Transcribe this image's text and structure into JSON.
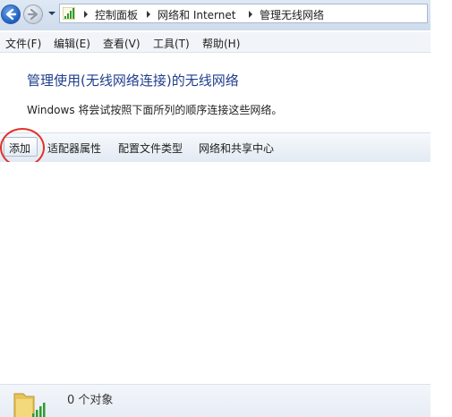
{
  "address_bar": {
    "breadcrumbs": [
      "控制面板",
      "网络和 Internet",
      "管理无线网络"
    ]
  },
  "menu": {
    "items": [
      "文件(F)",
      "编辑(E)",
      "查看(V)",
      "工具(T)",
      "帮助(H)"
    ]
  },
  "header": {
    "title": "管理使用(无线网络连接)的无线网络",
    "description": "Windows 将尝试按照下面所列的顺序连接这些网络。"
  },
  "commands": {
    "add": "添加",
    "adapter_properties": "适配器属性",
    "profile_types": "配置文件类型",
    "network_sharing_center": "网络和共享中心"
  },
  "details": {
    "item_count": "0 个对象"
  },
  "colors": {
    "title": "#1f3f8c",
    "highlight_circle": "#e0332b"
  }
}
